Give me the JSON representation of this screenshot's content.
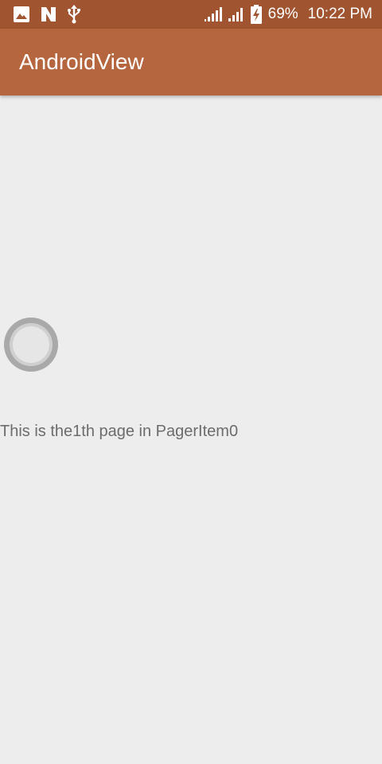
{
  "status_bar": {
    "battery_percent": "69%",
    "time": "10:22 PM",
    "left_icons": [
      "image-icon",
      "n-notification-icon",
      "usb-icon"
    ],
    "right_icons": [
      "signal-icon",
      "signal-icon",
      "battery-charging-icon"
    ]
  },
  "app_bar": {
    "title": "AndroidView"
  },
  "content": {
    "page_text": "This is the1th page in PagerItem0"
  },
  "colors": {
    "status_bar": "#a0542f",
    "app_bar": "#b5663e",
    "background": "#ededed"
  }
}
